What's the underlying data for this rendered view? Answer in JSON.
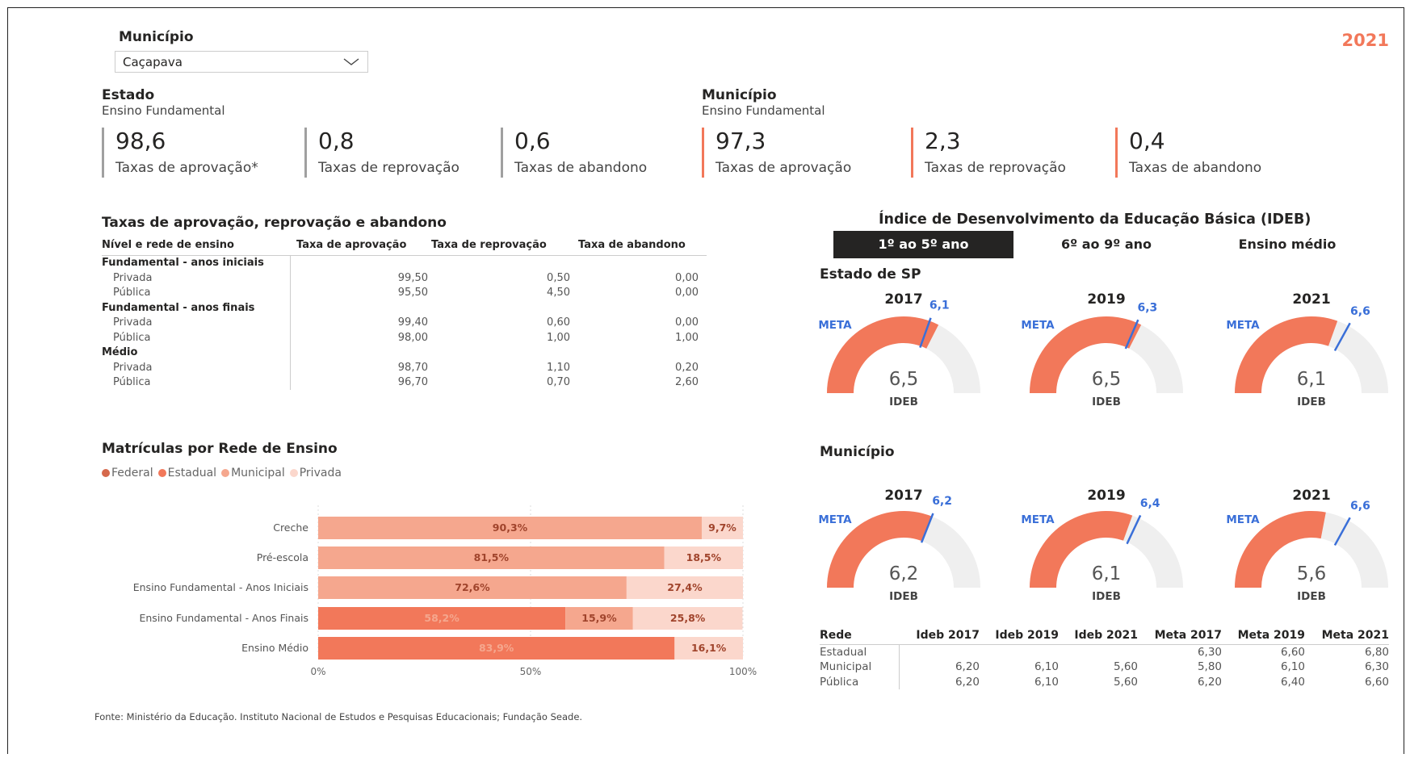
{
  "filter": {
    "label": "Município",
    "selected": "Caçapava"
  },
  "year_badge": "2021",
  "estado": {
    "title": "Estado",
    "subtitle": "Ensino Fundamental",
    "kpis": [
      {
        "value": "98,6",
        "caption": "Taxas de aprovação*"
      },
      {
        "value": "0,8",
        "caption": "Taxas de reprovação"
      },
      {
        "value": "0,6",
        "caption": "Taxas de abandono"
      }
    ]
  },
  "municipio": {
    "title": "Município",
    "subtitle": "Ensino Fundamental",
    "kpis": [
      {
        "value": "97,3",
        "caption": "Taxas de aprovação"
      },
      {
        "value": "2,3",
        "caption": "Taxas de reprovação"
      },
      {
        "value": "0,4",
        "caption": "Taxas de abandono"
      }
    ]
  },
  "rates_table": {
    "title": "Taxas de aprovação, reprovação e abandono",
    "headers": [
      "Nível e rede de ensino",
      "Taxa de aprovação",
      "Taxa de reprovação",
      "Taxa de abandono"
    ],
    "groups": [
      {
        "name": "Fundamental - anos iniciais",
        "rows": [
          [
            "Privada",
            "99,50",
            "0,50",
            "0,00"
          ],
          [
            "Pública",
            "95,50",
            "4,50",
            "0,00"
          ]
        ]
      },
      {
        "name": "Fundamental - anos finais",
        "rows": [
          [
            "Privada",
            "99,40",
            "0,60",
            "0,00"
          ],
          [
            "Pública",
            "98,00",
            "1,00",
            "1,00"
          ]
        ]
      },
      {
        "name": "Médio",
        "rows": [
          [
            "Privada",
            "98,70",
            "1,10",
            "0,20"
          ],
          [
            "Pública",
            "96,70",
            "0,70",
            "2,60"
          ]
        ]
      }
    ]
  },
  "colors": {
    "federal": "#d5684b",
    "estadual": "#f2785a",
    "municipal": "#f5a78e",
    "privada": "#fbd7cc",
    "accent": "#f2785a",
    "gray_bar": "#a0a0a0",
    "meta_blue": "#3a6fd8",
    "gauge_bg": "#efefef",
    "tab_active": "#252423"
  },
  "chart_data": [
    {
      "type": "bar",
      "orientation": "horizontal-stacked-100",
      "title": "Matrículas por Rede de Ensino",
      "categories": [
        "Creche",
        "Pré-escola",
        "Ensino Fundamental - Anos Iniciais",
        "Ensino Fundamental - Anos Finais",
        "Ensino Médio"
      ],
      "series": [
        {
          "name": "Federal",
          "values": [
            0,
            0,
            0,
            0,
            0
          ]
        },
        {
          "name": "Estadual",
          "values": [
            0,
            0,
            0,
            58.2,
            83.9
          ]
        },
        {
          "name": "Municipal",
          "values": [
            90.3,
            81.5,
            72.6,
            15.9,
            0
          ]
        },
        {
          "name": "Privada",
          "values": [
            9.7,
            18.5,
            27.4,
            25.8,
            16.1
          ]
        }
      ],
      "data_labels": [
        [
          "90,3%",
          "9,7%"
        ],
        [
          "81,5%",
          "18,5%"
        ],
        [
          "72,6%",
          "27,4%"
        ],
        [
          "58,2%",
          "15,9%",
          "25,8%"
        ],
        [
          "83,9%",
          "16,1%"
        ]
      ],
      "xticks": [
        "0%",
        "50%",
        "100%"
      ],
      "xlim": [
        0,
        100
      ],
      "legend": "top-left",
      "grid": true
    },
    {
      "type": "gauge",
      "title": "Índice de Desenvolvimento da Educação Básica (IDEB)",
      "tabs": [
        "1º ao 5º ano",
        "6º ao 9º ano",
        "Ensino médio"
      ],
      "active_tab": "1º ao 5º ano",
      "panels": [
        {
          "name": "Estado de SP",
          "gauges": [
            {
              "year": "2017",
              "value": 6.5,
              "value_label": "6,5",
              "meta": 6.1,
              "meta_label": "6,1"
            },
            {
              "year": "2019",
              "value": 6.5,
              "value_label": "6,5",
              "meta": 6.3,
              "meta_label": "6,3"
            },
            {
              "year": "2021",
              "value": 6.1,
              "value_label": "6,1",
              "meta": 6.6,
              "meta_label": "6,6"
            }
          ]
        },
        {
          "name": "Município",
          "gauges": [
            {
              "year": "2017",
              "value": 6.2,
              "value_label": "6,2",
              "meta": 6.2,
              "meta_label": "6,2"
            },
            {
              "year": "2019",
              "value": 6.1,
              "value_label": "6,1",
              "meta": 6.4,
              "meta_label": "6,4"
            },
            {
              "year": "2021",
              "value": 5.6,
              "value_label": "5,6",
              "meta": 6.6,
              "meta_label": "6,6"
            }
          ]
        }
      ],
      "meta_text": "META",
      "value_caption": "IDEB"
    }
  ],
  "ideb_table": {
    "headers": [
      "Rede",
      "Ideb 2017",
      "Ideb 2019",
      "Ideb 2021",
      "Meta 2017",
      "Meta 2019",
      "Meta 2021"
    ],
    "rows": [
      [
        "Estadual",
        "",
        "",
        "",
        "6,30",
        "6,60",
        "6,80"
      ],
      [
        "Municipal",
        "6,20",
        "6,10",
        "5,60",
        "5,80",
        "6,10",
        "6,30"
      ],
      [
        "Pública",
        "6,20",
        "6,10",
        "5,60",
        "6,20",
        "6,40",
        "6,60"
      ]
    ]
  },
  "footer": "Fonte: Ministério da Educação. Instituto Nacional de Estudos e Pesquisas Educacionais; Fundação Seade."
}
